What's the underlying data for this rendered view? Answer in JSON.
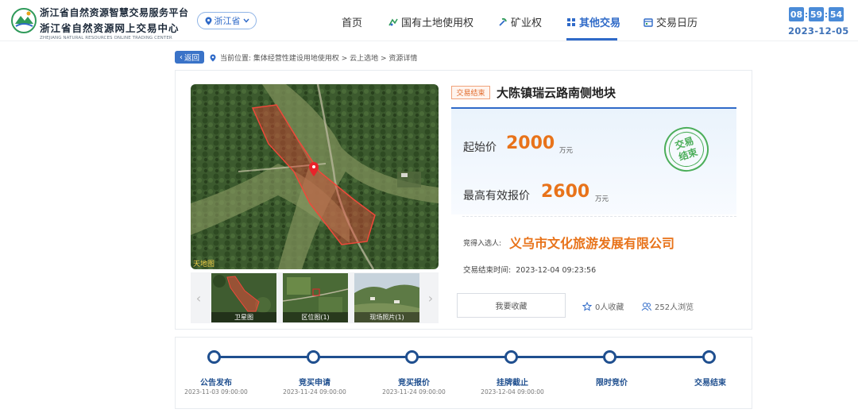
{
  "header": {
    "title_cn_1": "浙江省自然资源智慧交易服务平台",
    "title_cn_2": "浙江省自然资源网上交易中心",
    "title_en": "ZHEJIANG NATURAL RESOURCES ONLINE TRADING CENTER",
    "province": "浙江省",
    "nav": [
      {
        "label": "首页",
        "icon": "none",
        "active": false
      },
      {
        "label": "国有土地使用权",
        "icon": "land-icon",
        "active": false
      },
      {
        "label": "矿业权",
        "icon": "mine-icon",
        "active": false
      },
      {
        "label": "其他交易",
        "icon": "grid-icon",
        "active": true
      },
      {
        "label": "交易日历",
        "icon": "calendar-icon",
        "active": false
      }
    ],
    "clock": {
      "h": "08",
      "m": "59",
      "s": "54"
    },
    "date": "2023-12-05"
  },
  "breadcrumb": {
    "back_label": "返回",
    "text": "当前位置: 集体经营性建设用地使用权 > 云上选地 > 资源详情"
  },
  "gallery": {
    "watermark": "天地图",
    "thumbs": [
      {
        "caption": "卫星图"
      },
      {
        "caption": "区位图(1)"
      },
      {
        "caption": "现场照片(1)"
      }
    ]
  },
  "detail": {
    "status_badge": "交易结束",
    "title": "大陈镇瑞云路南侧地块",
    "start_price_label": "起始价",
    "start_price": "2000",
    "start_unit": "万元",
    "top_bid_label": "最高有效报价",
    "top_bid": "2600",
    "top_unit": "万元",
    "stamp_line1": "交易",
    "stamp_line2": "结束",
    "winner_label": "竞得入选人:",
    "winner": "义乌市文化旅游发展有限公司",
    "end_time_label": "交易结束时间:",
    "end_time": "2023-12-04 09:23:56",
    "fav_button": "我要收藏",
    "fav_count": "0人收藏",
    "view_count": "252人浏览"
  },
  "timeline": [
    {
      "label": "公告发布",
      "date": "2023-11-03 09:00:00"
    },
    {
      "label": "竞买申请",
      "date": "2023-11-24 09:00:00"
    },
    {
      "label": "竞买报价",
      "date": "2023-11-24 09:00:00"
    },
    {
      "label": "挂牌截止",
      "date": "2023-12-04 09:00:00"
    },
    {
      "label": "限时竞价",
      "date": ""
    },
    {
      "label": "交易结束",
      "date": ""
    }
  ],
  "colors": {
    "accent": "#2f6ac8",
    "price": "#e8731a",
    "stamp": "#4cae5a",
    "timeline": "#1f4f8f"
  }
}
